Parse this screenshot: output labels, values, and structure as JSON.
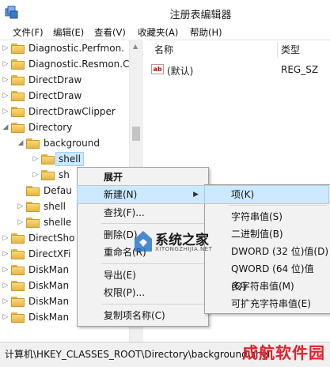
{
  "window": {
    "title": "注册表编辑器"
  },
  "menubar": [
    "文件(F)",
    "编辑(E)",
    "查看(V)",
    "收藏夹(A)",
    "帮助(H)"
  ],
  "tree": [
    {
      "label": "Diagnostic.Perfmon.",
      "arrow": "right",
      "depth": 1
    },
    {
      "label": "Diagnostic.Resmon.C",
      "arrow": "right",
      "depth": 1
    },
    {
      "label": "DirectDraw",
      "arrow": "right",
      "depth": 1
    },
    {
      "label": "DirectDraw",
      "arrow": "right",
      "depth": 1
    },
    {
      "label": "DirectDrawClipper",
      "arrow": "right",
      "depth": 1
    },
    {
      "label": "Directory",
      "arrow": "down",
      "depth": 1
    },
    {
      "label": "background",
      "arrow": "down",
      "depth": 2
    },
    {
      "label": "shell",
      "arrow": "right",
      "depth": 3,
      "selected": true
    },
    {
      "label": "sh",
      "arrow": "right",
      "depth": 3
    },
    {
      "label": "Defau",
      "arrow": "",
      "depth": 2
    },
    {
      "label": "shell",
      "arrow": "right",
      "depth": 2
    },
    {
      "label": "shelle",
      "arrow": "right",
      "depth": 2
    },
    {
      "label": "DirectSho",
      "arrow": "right",
      "depth": 1
    },
    {
      "label": "DirectXFi",
      "arrow": "right",
      "depth": 1
    },
    {
      "label": "DiskMan",
      "arrow": "right",
      "depth": 1
    },
    {
      "label": "DiskMan",
      "arrow": "right",
      "depth": 1
    },
    {
      "label": "DiskMan",
      "arrow": "right",
      "depth": 1
    },
    {
      "label": "DiskMan",
      "arrow": "right",
      "depth": 1
    }
  ],
  "list": {
    "columns": {
      "name": "名称",
      "type": "类型"
    },
    "rows": [
      {
        "icon": "ab",
        "name": "(默认)",
        "type": "REG_SZ"
      }
    ]
  },
  "context_menu": {
    "expand": "展开",
    "new": "新建(N)",
    "find": "查找(F)...",
    "delete": "删除(D)",
    "rename": "重命名(R)",
    "export": "导出(E)",
    "permissions": "权限(P)...",
    "copy_key_name": "复制项名称(C)"
  },
  "submenu": {
    "key": "项(K)",
    "string": "字符串值(S)",
    "binary": "二进制值(B)",
    "dword": "DWORD (32 位)值(D)",
    "qword": "QWORD (64 位)值(Q)",
    "multi_string": "多字符串值(M)",
    "expandable_string": "可扩充字符串值(E)"
  },
  "statusbar": {
    "path": "计算机\\HKEY_CLASSES_ROOT\\Directory\\background\\shell"
  },
  "watermarks": {
    "center_text": "系统之家",
    "center_sub": "XITONGZHIJIA.NET",
    "corner_text": "成航软件园"
  },
  "colors": {
    "selection": "#cde8ff",
    "watermark_red": "#e8202a",
    "folder": "#e8b545"
  }
}
